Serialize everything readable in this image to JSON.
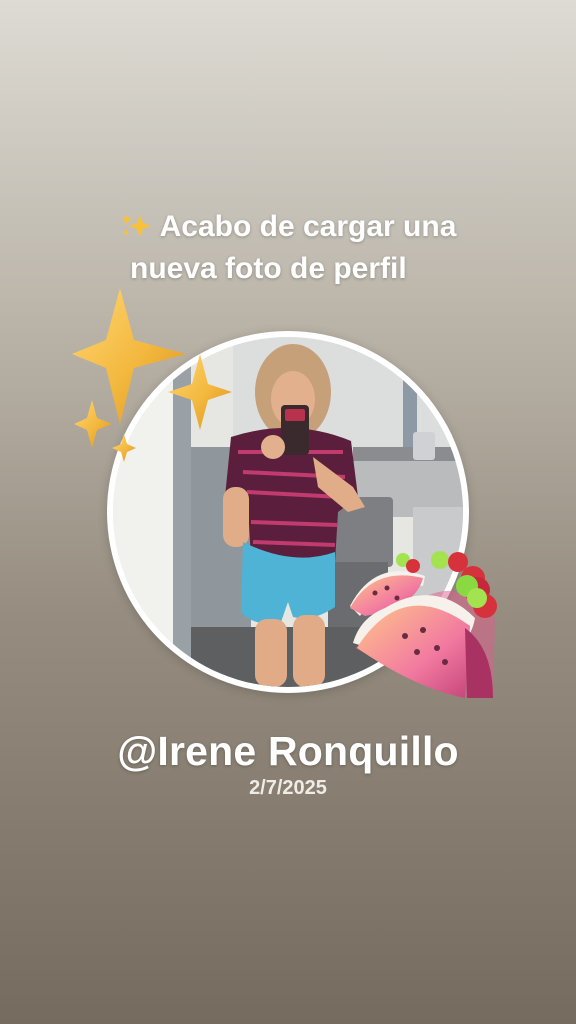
{
  "story": {
    "headline_emoji": "sparkles-icon",
    "headline_line1": "Acabo de cargar una",
    "headline_line2": "nueva foto de perfil",
    "username": "@Irene Ronquillo",
    "date": "2/7/2025"
  },
  "stickers": [
    "sparkles-sticker",
    "taco-sticker"
  ],
  "colors": {
    "background_top": "#dddbd4",
    "background_bottom": "#756b5f",
    "text": "#ffffff",
    "avatar_border": "#ffffff",
    "star_gold": "#f3b83e"
  }
}
